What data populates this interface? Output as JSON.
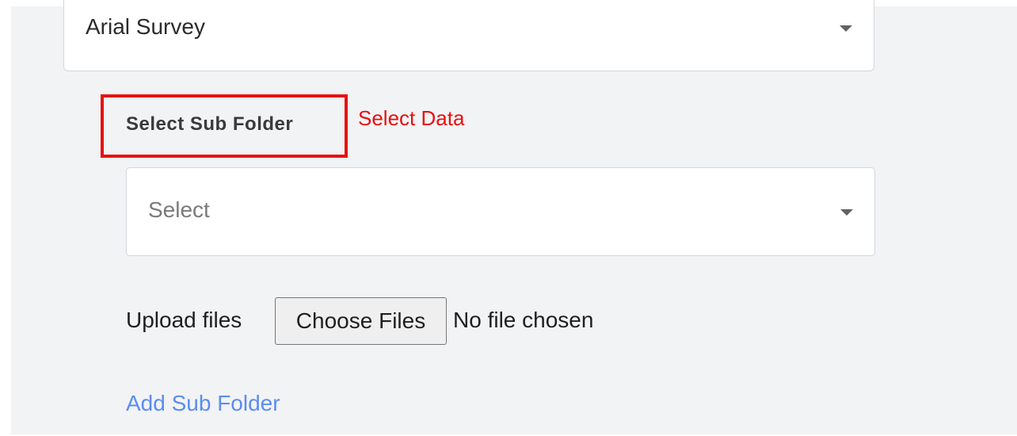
{
  "category_select": {
    "value": "Arial Survey",
    "icon": "chevron-down-icon"
  },
  "subfolder": {
    "label": "Select Sub Folder",
    "placeholder": "Select",
    "icon": "chevron-down-icon"
  },
  "annotation": {
    "text": "Select Data",
    "color": "#e81010"
  },
  "upload": {
    "label": "Upload files",
    "button_label": "Choose Files",
    "status": "No file chosen"
  },
  "add_subfolder": {
    "label": "Add Sub Folder",
    "color": "#5b8def"
  }
}
